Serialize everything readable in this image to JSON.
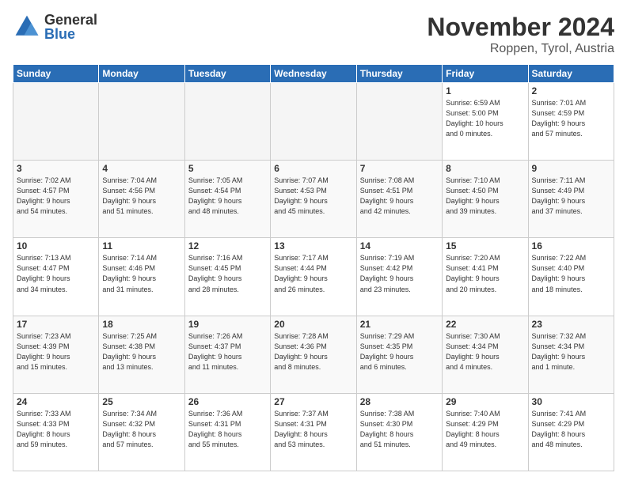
{
  "logo": {
    "general": "General",
    "blue": "Blue"
  },
  "title": "November 2024",
  "location": "Roppen, Tyrol, Austria",
  "days_header": [
    "Sunday",
    "Monday",
    "Tuesday",
    "Wednesday",
    "Thursday",
    "Friday",
    "Saturday"
  ],
  "weeks": [
    [
      {
        "day": "",
        "info": ""
      },
      {
        "day": "",
        "info": ""
      },
      {
        "day": "",
        "info": ""
      },
      {
        "day": "",
        "info": ""
      },
      {
        "day": "",
        "info": ""
      },
      {
        "day": "1",
        "info": "Sunrise: 6:59 AM\nSunset: 5:00 PM\nDaylight: 10 hours\nand 0 minutes."
      },
      {
        "day": "2",
        "info": "Sunrise: 7:01 AM\nSunset: 4:59 PM\nDaylight: 9 hours\nand 57 minutes."
      }
    ],
    [
      {
        "day": "3",
        "info": "Sunrise: 7:02 AM\nSunset: 4:57 PM\nDaylight: 9 hours\nand 54 minutes."
      },
      {
        "day": "4",
        "info": "Sunrise: 7:04 AM\nSunset: 4:56 PM\nDaylight: 9 hours\nand 51 minutes."
      },
      {
        "day": "5",
        "info": "Sunrise: 7:05 AM\nSunset: 4:54 PM\nDaylight: 9 hours\nand 48 minutes."
      },
      {
        "day": "6",
        "info": "Sunrise: 7:07 AM\nSunset: 4:53 PM\nDaylight: 9 hours\nand 45 minutes."
      },
      {
        "day": "7",
        "info": "Sunrise: 7:08 AM\nSunset: 4:51 PM\nDaylight: 9 hours\nand 42 minutes."
      },
      {
        "day": "8",
        "info": "Sunrise: 7:10 AM\nSunset: 4:50 PM\nDaylight: 9 hours\nand 39 minutes."
      },
      {
        "day": "9",
        "info": "Sunrise: 7:11 AM\nSunset: 4:49 PM\nDaylight: 9 hours\nand 37 minutes."
      }
    ],
    [
      {
        "day": "10",
        "info": "Sunrise: 7:13 AM\nSunset: 4:47 PM\nDaylight: 9 hours\nand 34 minutes."
      },
      {
        "day": "11",
        "info": "Sunrise: 7:14 AM\nSunset: 4:46 PM\nDaylight: 9 hours\nand 31 minutes."
      },
      {
        "day": "12",
        "info": "Sunrise: 7:16 AM\nSunset: 4:45 PM\nDaylight: 9 hours\nand 28 minutes."
      },
      {
        "day": "13",
        "info": "Sunrise: 7:17 AM\nSunset: 4:44 PM\nDaylight: 9 hours\nand 26 minutes."
      },
      {
        "day": "14",
        "info": "Sunrise: 7:19 AM\nSunset: 4:42 PM\nDaylight: 9 hours\nand 23 minutes."
      },
      {
        "day": "15",
        "info": "Sunrise: 7:20 AM\nSunset: 4:41 PM\nDaylight: 9 hours\nand 20 minutes."
      },
      {
        "day": "16",
        "info": "Sunrise: 7:22 AM\nSunset: 4:40 PM\nDaylight: 9 hours\nand 18 minutes."
      }
    ],
    [
      {
        "day": "17",
        "info": "Sunrise: 7:23 AM\nSunset: 4:39 PM\nDaylight: 9 hours\nand 15 minutes."
      },
      {
        "day": "18",
        "info": "Sunrise: 7:25 AM\nSunset: 4:38 PM\nDaylight: 9 hours\nand 13 minutes."
      },
      {
        "day": "19",
        "info": "Sunrise: 7:26 AM\nSunset: 4:37 PM\nDaylight: 9 hours\nand 11 minutes."
      },
      {
        "day": "20",
        "info": "Sunrise: 7:28 AM\nSunset: 4:36 PM\nDaylight: 9 hours\nand 8 minutes."
      },
      {
        "day": "21",
        "info": "Sunrise: 7:29 AM\nSunset: 4:35 PM\nDaylight: 9 hours\nand 6 minutes."
      },
      {
        "day": "22",
        "info": "Sunrise: 7:30 AM\nSunset: 4:34 PM\nDaylight: 9 hours\nand 4 minutes."
      },
      {
        "day": "23",
        "info": "Sunrise: 7:32 AM\nSunset: 4:34 PM\nDaylight: 9 hours\nand 1 minute."
      }
    ],
    [
      {
        "day": "24",
        "info": "Sunrise: 7:33 AM\nSunset: 4:33 PM\nDaylight: 8 hours\nand 59 minutes."
      },
      {
        "day": "25",
        "info": "Sunrise: 7:34 AM\nSunset: 4:32 PM\nDaylight: 8 hours\nand 57 minutes."
      },
      {
        "day": "26",
        "info": "Sunrise: 7:36 AM\nSunset: 4:31 PM\nDaylight: 8 hours\nand 55 minutes."
      },
      {
        "day": "27",
        "info": "Sunrise: 7:37 AM\nSunset: 4:31 PM\nDaylight: 8 hours\nand 53 minutes."
      },
      {
        "day": "28",
        "info": "Sunrise: 7:38 AM\nSunset: 4:30 PM\nDaylight: 8 hours\nand 51 minutes."
      },
      {
        "day": "29",
        "info": "Sunrise: 7:40 AM\nSunset: 4:29 PM\nDaylight: 8 hours\nand 49 minutes."
      },
      {
        "day": "30",
        "info": "Sunrise: 7:41 AM\nSunset: 4:29 PM\nDaylight: 8 hours\nand 48 minutes."
      }
    ]
  ]
}
